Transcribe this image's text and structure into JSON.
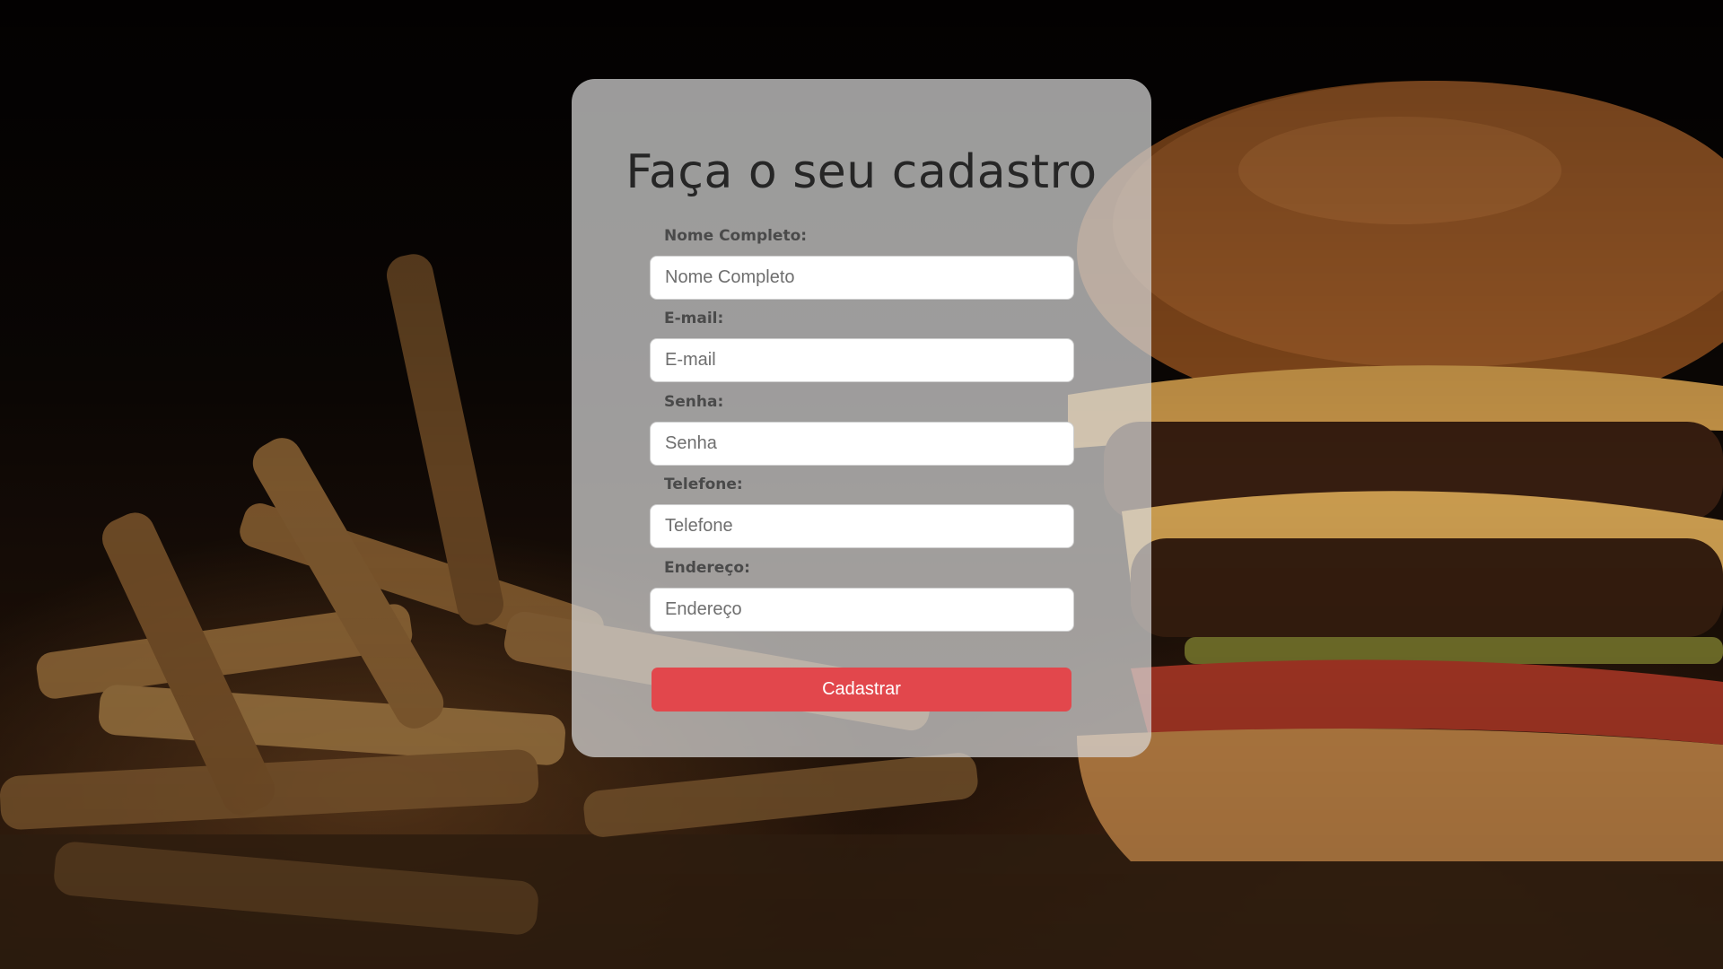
{
  "page": {
    "title": "Faça o seu cadastro"
  },
  "form": {
    "fields": [
      {
        "label": "Nome Completo:",
        "placeholder": "Nome Completo",
        "value": ""
      },
      {
        "label": "E-mail:",
        "placeholder": "E-mail",
        "value": ""
      },
      {
        "label": "Senha:",
        "placeholder": "Senha",
        "value": ""
      },
      {
        "label": "Telefone:",
        "placeholder": "Telefone",
        "value": ""
      },
      {
        "label": "Endereço:",
        "placeholder": "Endereço",
        "value": ""
      }
    ],
    "submit_label": "Cadastrar"
  },
  "colors": {
    "card_background": "#d7d7d7",
    "button": "#e2474c",
    "title": "#262626",
    "label": "#4a4a4a"
  }
}
